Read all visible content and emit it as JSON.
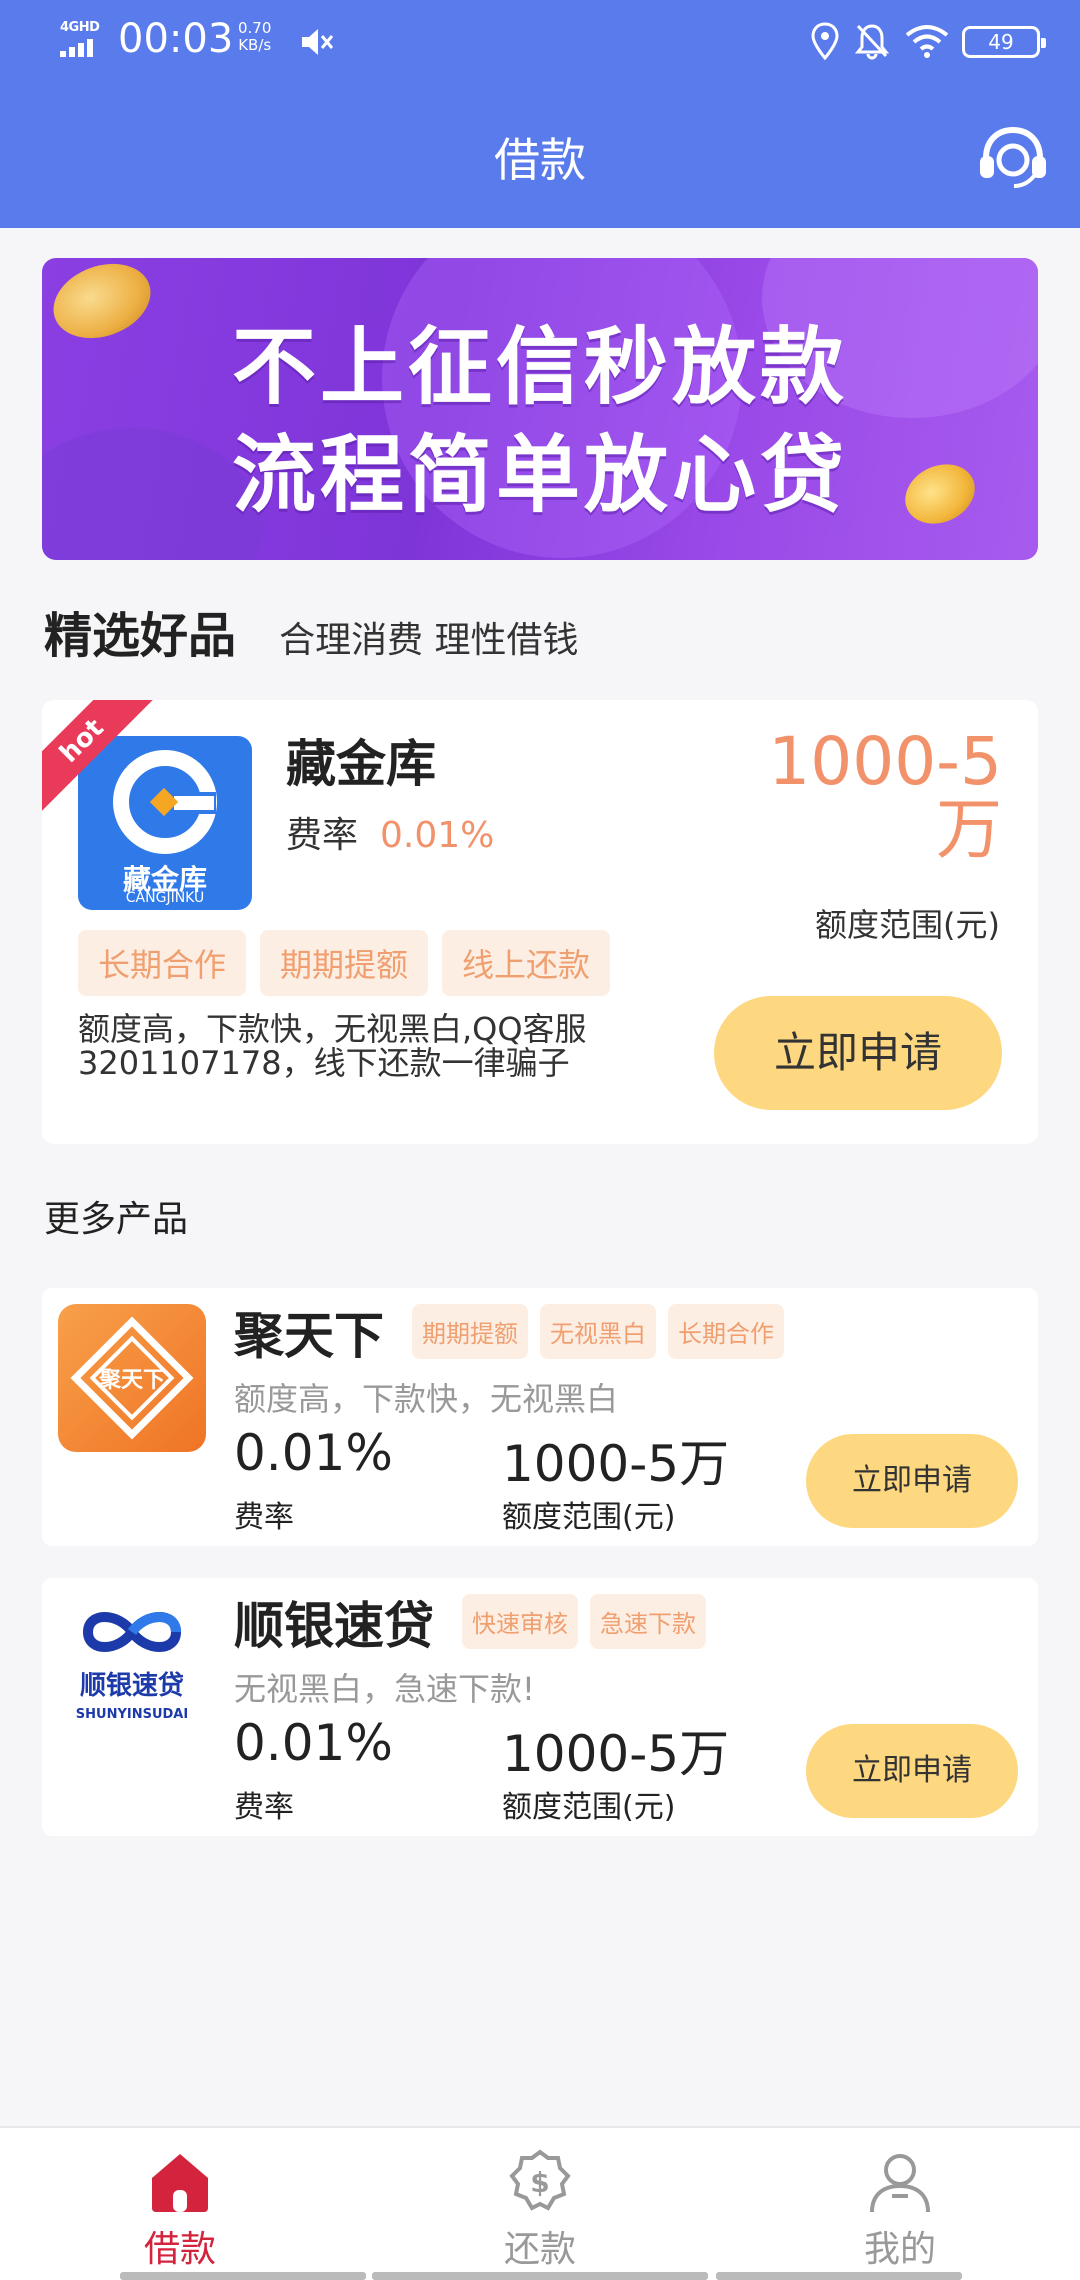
{
  "status_bar": {
    "network": "4GHD",
    "time": "00:03",
    "speed_value": "0.70",
    "speed_unit": "KB/s",
    "battery": "49",
    "icons": [
      "signal-icon",
      "mute-icon",
      "location-icon",
      "bell-off-icon",
      "wifi-icon",
      "battery-icon"
    ]
  },
  "header": {
    "title": "借款",
    "right_icon": "customer-service-icon"
  },
  "banner": {
    "line1": "不上征信秒放款",
    "line2": "流程简单放心贷"
  },
  "featured_section": {
    "title": "精选好品",
    "subtitle": "合理消费 理性借钱"
  },
  "featured": {
    "badge": "hot",
    "logo_text": "藏金库",
    "logo_subtext": "CANGJINKU",
    "name": "藏金库",
    "rate_label": "费率",
    "rate_value": "0.01%",
    "amount_line1": "1000-5",
    "amount_line2": "万",
    "amount_label": "额度范围(元)",
    "tags": [
      "长期合作",
      "期期提额",
      "线上还款"
    ],
    "description": "额度高，下款快，无视黑白,QQ客服3201107178，线下还款一律骗子",
    "apply_label": "立即申请"
  },
  "more_section": {
    "title": "更多产品"
  },
  "products": [
    {
      "name": "聚天下",
      "logo_text": "聚天下",
      "tags": [
        "期期提额",
        "无视黑白",
        "长期合作"
      ],
      "description": "额度高，下款快，无视黑白",
      "rate_value": "0.01%",
      "rate_label": "费率",
      "amount_value": "1000-5万",
      "amount_label": "额度范围(元)",
      "apply_label": "立即申请"
    },
    {
      "name": "顺银速贷",
      "logo_text": "顺银速贷",
      "logo_subtext": "SHUNYINSUDAI",
      "tags": [
        "快速审核",
        "急速下款"
      ],
      "description": "无视黑白，急速下款!",
      "rate_value": "0.01%",
      "rate_label": "费率",
      "amount_value": "1000-5万",
      "amount_label": "额度范围(元)",
      "apply_label": "立即申请"
    }
  ],
  "tabbar": {
    "tabs": [
      {
        "label": "借款",
        "icon": "home-icon",
        "active": true
      },
      {
        "label": "还款",
        "icon": "dollar-badge-icon",
        "active": false
      },
      {
        "label": "我的",
        "icon": "user-icon",
        "active": false
      }
    ]
  },
  "colors": {
    "header_bg": "#5a7bec",
    "accent_orange": "#f2926b",
    "apply_button": "#fdd880",
    "tab_active": "#d4243d",
    "tag_bg": "#fdeee3"
  }
}
